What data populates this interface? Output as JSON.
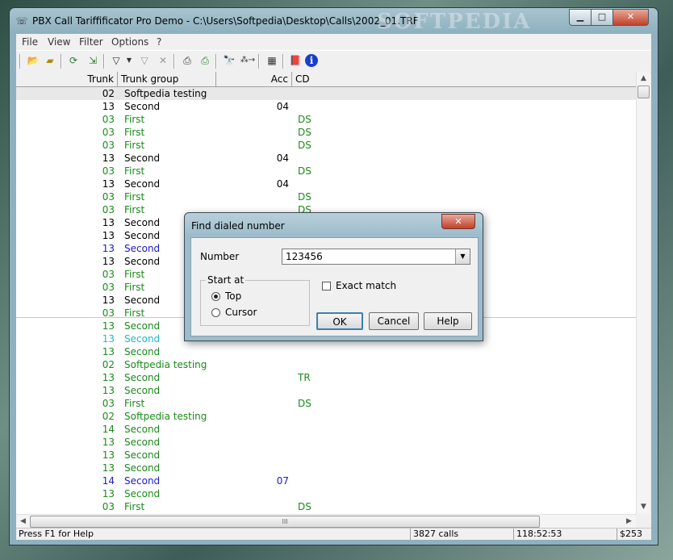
{
  "window": {
    "title": "PBX Call Tariffificator Pro Demo - C:\\Users\\Softpedia\\Desktop\\Calls\\2002_01.TRF",
    "watermark": "SOFTPEDIA"
  },
  "menu": [
    "File",
    "View",
    "Filter",
    "Options",
    "?"
  ],
  "toolbar_icons": [
    "open-folder-icon",
    "folder-icon",
    "refresh-icon",
    "export-icon",
    "filter-icon",
    "filter-dropdown-icon",
    "filter-clear-icon",
    "filter-remove-icon",
    "print-icon",
    "print-preview-icon",
    "binoculars-find-icon",
    "find-next-icon",
    "table-icon",
    "book-icon",
    "info-icon"
  ],
  "grid": {
    "columns": [
      "Trunk",
      "Trunk group",
      "Acc",
      "CD"
    ],
    "rows": [
      {
        "trunk": "02",
        "group": "Softpedia testing",
        "acc": "",
        "cd": "",
        "color": "#000000",
        "selected": true
      },
      {
        "trunk": "13",
        "group": "Second",
        "acc": "04",
        "cd": "",
        "color": "#000000"
      },
      {
        "trunk": "03",
        "group": "First",
        "acc": "",
        "cd": "DS",
        "color": "#1a8a1a"
      },
      {
        "trunk": "03",
        "group": "First",
        "acc": "",
        "cd": "DS",
        "color": "#1a8a1a"
      },
      {
        "trunk": "03",
        "group": "First",
        "acc": "",
        "cd": "DS",
        "color": "#1a8a1a"
      },
      {
        "trunk": "13",
        "group": "Second",
        "acc": "04",
        "cd": "",
        "color": "#000000"
      },
      {
        "trunk": "03",
        "group": "First",
        "acc": "",
        "cd": "DS",
        "color": "#1a8a1a"
      },
      {
        "trunk": "13",
        "group": "Second",
        "acc": "04",
        "cd": "",
        "color": "#000000"
      },
      {
        "trunk": "03",
        "group": "First",
        "acc": "",
        "cd": "DS",
        "color": "#1a8a1a"
      },
      {
        "trunk": "03",
        "group": "First",
        "acc": "",
        "cd": "DS",
        "color": "#1a8a1a"
      },
      {
        "trunk": "13",
        "group": "Second",
        "acc": "",
        "cd": "",
        "color": "#000000"
      },
      {
        "trunk": "13",
        "group": "Second",
        "acc": "",
        "cd": "",
        "color": "#000000"
      },
      {
        "trunk": "13",
        "group": "Second",
        "acc": "",
        "cd": "",
        "color": "#1a1acc"
      },
      {
        "trunk": "13",
        "group": "Second",
        "acc": "",
        "cd": "",
        "color": "#000000"
      },
      {
        "trunk": "03",
        "group": "First",
        "acc": "",
        "cd": "",
        "color": "#1a8a1a"
      },
      {
        "trunk": "03",
        "group": "First",
        "acc": "",
        "cd": "",
        "color": "#1a8a1a"
      },
      {
        "trunk": "13",
        "group": "Second",
        "acc": "",
        "cd": "",
        "color": "#000000"
      },
      {
        "trunk": "03",
        "group": "First",
        "acc": "",
        "cd": "",
        "color": "#1a8a1a"
      },
      {
        "trunk": "13",
        "group": "Second",
        "acc": "",
        "cd": "",
        "color": "#1a8a1a"
      },
      {
        "trunk": "13",
        "group": "Second",
        "acc": "",
        "cd": "",
        "color": "#22b8c8"
      },
      {
        "trunk": "13",
        "group": "Second",
        "acc": "",
        "cd": "",
        "color": "#1a8a1a"
      },
      {
        "trunk": "02",
        "group": "Softpedia testing",
        "acc": "",
        "cd": "",
        "color": "#1a8a1a"
      },
      {
        "trunk": "13",
        "group": "Second",
        "acc": "",
        "cd": "TR",
        "color": "#1a8a1a"
      },
      {
        "trunk": "13",
        "group": "Second",
        "acc": "",
        "cd": "",
        "color": "#1a8a1a"
      },
      {
        "trunk": "03",
        "group": "First",
        "acc": "",
        "cd": "DS",
        "color": "#1a8a1a"
      },
      {
        "trunk": "02",
        "group": "Softpedia testing",
        "acc": "",
        "cd": "",
        "color": "#1a8a1a"
      },
      {
        "trunk": "14",
        "group": "Second",
        "acc": "",
        "cd": "",
        "color": "#1a8a1a"
      },
      {
        "trunk": "13",
        "group": "Second",
        "acc": "",
        "cd": "",
        "color": "#1a8a1a"
      },
      {
        "trunk": "13",
        "group": "Second",
        "acc": "",
        "cd": "",
        "color": "#1a8a1a"
      },
      {
        "trunk": "13",
        "group": "Second",
        "acc": "",
        "cd": "",
        "color": "#1a8a1a"
      },
      {
        "trunk": "14",
        "group": "Second",
        "acc": "07",
        "cd": "",
        "color": "#1a1acc"
      },
      {
        "trunk": "13",
        "group": "Second",
        "acc": "",
        "cd": "",
        "color": "#1a8a1a"
      },
      {
        "trunk": "03",
        "group": "First",
        "acc": "",
        "cd": "DS",
        "color": "#1a8a1a"
      }
    ]
  },
  "hscroll_label": "III",
  "status": {
    "help": "Press F1 for Help",
    "calls": "3827 calls",
    "time": "118:52:53",
    "cost": "$253"
  },
  "dialog": {
    "title": "Find dialed number",
    "number_label": "Number",
    "number_value": "123456",
    "start_at_label": "Start at",
    "top_label": "Top",
    "cursor_label": "Cursor",
    "start_at_selected": "Top",
    "exact_match_label": "Exact match",
    "exact_match_checked": false,
    "ok_label": "OK",
    "cancel_label": "Cancel",
    "help_label": "Help",
    "close_symbol": "✕"
  }
}
